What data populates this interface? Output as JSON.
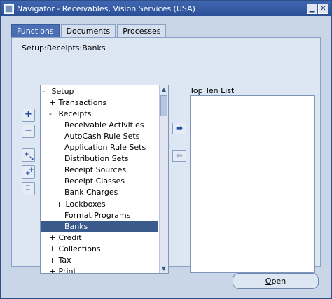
{
  "window": {
    "title": "Navigator - Receivables, Vision Services (USA)",
    "minimize_glyph": "▁",
    "close_glyph": "✕"
  },
  "tabs": [
    {
      "label": "Functions",
      "active": true
    },
    {
      "label": "Documents",
      "active": false
    },
    {
      "label": "Processes",
      "active": false
    }
  ],
  "breadcrumb": "Setup:Receipts:Banks",
  "side_buttons": {
    "expand": "+",
    "collapse": "−",
    "expand_branch": "+",
    "expand_all": "+",
    "collapse_all": "−"
  },
  "tree": {
    "items": [
      {
        "expander": "-",
        "label": "Setup"
      },
      {
        "expander": "+",
        "label": "Transactions"
      },
      {
        "expander": "-",
        "label": "Receipts"
      },
      {
        "expander": "",
        "label": "Receivable Activities"
      },
      {
        "expander": "",
        "label": "AutoCash Rule Sets"
      },
      {
        "expander": "",
        "label": "Application Rule Sets"
      },
      {
        "expander": "",
        "label": "Distribution Sets"
      },
      {
        "expander": "",
        "label": "Receipt Sources"
      },
      {
        "expander": "",
        "label": "Receipt Classes"
      },
      {
        "expander": "",
        "label": "Bank Charges"
      },
      {
        "expander": "+",
        "label": "Lockboxes"
      },
      {
        "expander": "",
        "label": "Format Programs"
      },
      {
        "expander": "",
        "label": "Banks",
        "selected": true
      },
      {
        "expander": "+",
        "label": "Credit"
      },
      {
        "expander": "+",
        "label": "Collections"
      },
      {
        "expander": "+",
        "label": "Tax"
      },
      {
        "expander": "+",
        "label": "Print"
      }
    ]
  },
  "scroll": {
    "up_glyph": "▲",
    "down_glyph": "▼"
  },
  "transfer": {
    "add_glyph": "➡",
    "remove_glyph": "⬅"
  },
  "top_ten": {
    "label": "Top Ten List",
    "items": []
  },
  "open_button": {
    "label_underlined": "O",
    "label_rest": "pen"
  },
  "colors": {
    "accent": "#3b5a8c",
    "tab_active": "#4a6fb5",
    "title_bar": "#2b4f95"
  }
}
